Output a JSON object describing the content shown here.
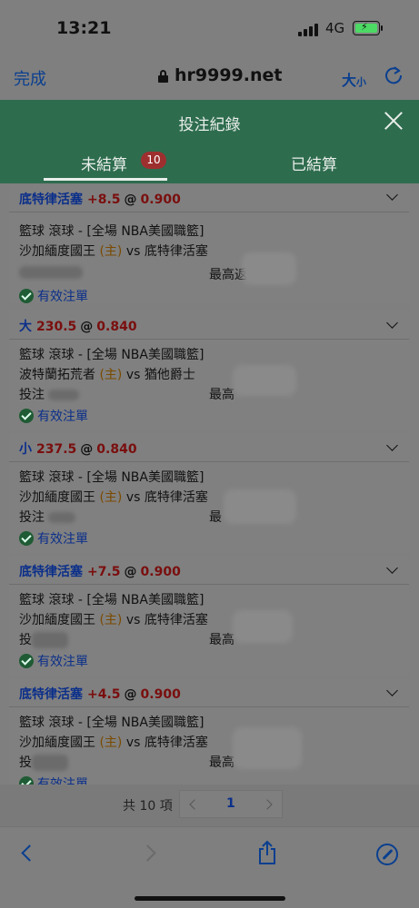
{
  "status_bar": {
    "time": "13:21",
    "network": "4G"
  },
  "browser": {
    "done_label": "完成",
    "url": "hr9999.net",
    "text_size_label": "大",
    "text_size_small": "小"
  },
  "modal": {
    "title": "投注紀錄"
  },
  "tabs": [
    {
      "label": "未結算",
      "badge": "10",
      "active": true
    },
    {
      "label": "已結算",
      "active": false
    }
  ],
  "bets": [
    {
      "selection": "底特律活塞",
      "line": "+8.5",
      "at": "@",
      "odds": "0.900",
      "league": "籃球 滾球 - [全場 NBA美國職籃]",
      "home": "沙加緬度國王",
      "home_tag": "(主)",
      "vs": "vs",
      "away": "底特律活塞",
      "stake_label": "",
      "max_label": "最高返",
      "status": "有效注單"
    },
    {
      "selection": "大",
      "line": "230.5",
      "at": "@",
      "odds": "0.840",
      "league": "籃球 滾球 - [全場 NBA美國職籃]",
      "home": "波特蘭拓荒者",
      "home_tag": "(主)",
      "vs": "vs",
      "away": "猶他爵士",
      "stake_label": "投注",
      "max_label": "最高",
      "status": "有效注單"
    },
    {
      "selection": "小",
      "line": "237.5",
      "at": "@",
      "odds": "0.840",
      "league": "籃球 滾球 - [全場 NBA美國職籃]",
      "home": "沙加緬度國王",
      "home_tag": "(主)",
      "vs": "vs",
      "away": "底特律活塞",
      "stake_label": "投注",
      "max_label": "最",
      "status": "有效注單"
    },
    {
      "selection": "底特律活塞",
      "line": "+7.5",
      "at": "@",
      "odds": "0.900",
      "league": "籃球 滾球 - [全場 NBA美國職籃]",
      "home": "沙加緬度國王",
      "home_tag": "(主)",
      "vs": "vs",
      "away": "底特律活塞",
      "stake_label": "投",
      "max_label": "最高",
      "status": "有效注單"
    },
    {
      "selection": "底特律活塞",
      "line": "+4.5",
      "at": "@",
      "odds": "0.900",
      "league": "籃球 滾球 - [全場 NBA美國職籃]",
      "home": "沙加緬度國王",
      "home_tag": "(主)",
      "vs": "vs",
      "away": "底特律活塞",
      "stake_label": "投",
      "max_label": "最高",
      "status": "有效注單"
    }
  ],
  "pager": {
    "total": "共 10 項",
    "page": "1"
  },
  "colors": {
    "header_green": "#2e6c4e",
    "badge_red": "#9e2f2f",
    "link_blue": "#0a3f8f"
  }
}
